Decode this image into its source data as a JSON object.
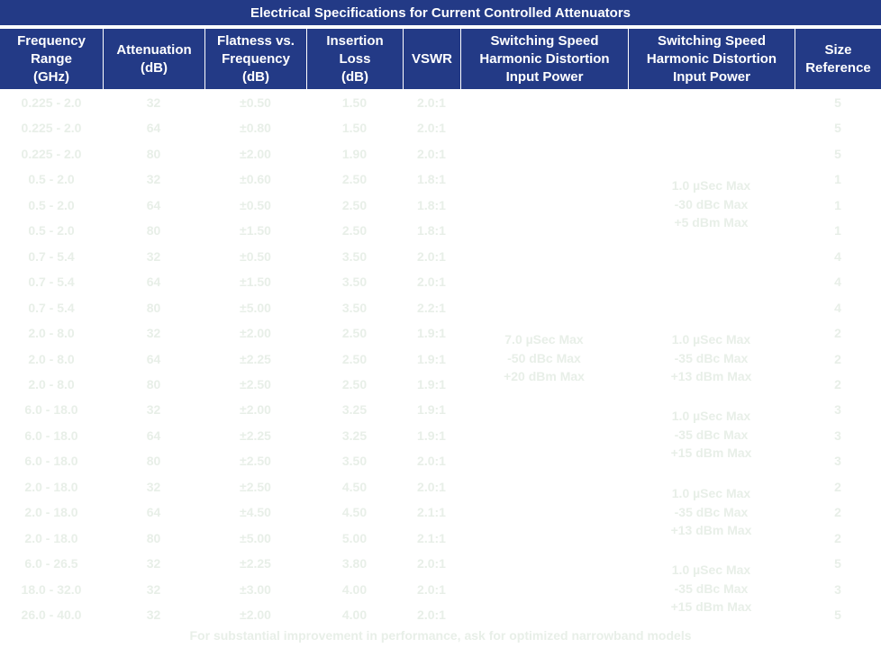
{
  "title": "Electrical Specifications for Current Controlled Attenuators",
  "headers": [
    [
      "Frequency",
      "Range",
      "(GHz)"
    ],
    [
      "Attenuation",
      "(dB)"
    ],
    [
      "Flatness vs.",
      "Frequency",
      "(dB)"
    ],
    [
      "Insertion",
      "Loss",
      "(dB)"
    ],
    [
      "VSWR"
    ],
    [
      "Switching Speed",
      "Harmonic Distortion",
      "Input Power"
    ],
    [
      "Switching Speed",
      "Harmonic Distortion",
      "Input Power"
    ],
    [
      "Size",
      "Reference"
    ]
  ],
  "rows": [
    [
      "0.225 - 2.0",
      "32",
      "±0.50",
      "1.50",
      "2.0:1",
      "5"
    ],
    [
      "0.225 - 2.0",
      "64",
      "±0.80",
      "1.50",
      "2.0:1",
      "5"
    ],
    [
      "0.225 - 2.0",
      "80",
      "±2.00",
      "1.90",
      "2.0:1",
      "5"
    ],
    [
      "0.5 - 2.0",
      "32",
      "±0.60",
      "2.50",
      "1.8:1",
      "1"
    ],
    [
      "0.5 - 2.0",
      "64",
      "±0.50",
      "2.50",
      "1.8:1",
      "1"
    ],
    [
      "0.5 - 2.0",
      "80",
      "±1.50",
      "2.50",
      "1.8:1",
      "1"
    ],
    [
      "0.7 - 5.4",
      "32",
      "±0.50",
      "3.50",
      "2.0:1",
      "4"
    ],
    [
      "0.7 - 5.4",
      "64",
      "±1.50",
      "3.50",
      "2.0:1",
      "4"
    ],
    [
      "0.7 - 5.4",
      "80",
      "±5.00",
      "3.50",
      "2.2:1",
      "4"
    ],
    [
      "2.0 - 8.0",
      "32",
      "±2.00",
      "2.50",
      "1.9:1",
      "2"
    ],
    [
      "2.0 - 8.0",
      "64",
      "±2.25",
      "2.50",
      "1.9:1",
      "2"
    ],
    [
      "2.0 - 8.0",
      "80",
      "±2.50",
      "2.50",
      "1.9:1",
      "2"
    ],
    [
      "6.0 - 18.0",
      "32",
      "±2.00",
      "3.25",
      "1.9:1",
      "3"
    ],
    [
      "6.0 - 18.0",
      "64",
      "±2.25",
      "3.25",
      "1.9:1",
      "3"
    ],
    [
      "6.0 - 18.0",
      "80",
      "±2.50",
      "3.50",
      "2.0:1",
      "3"
    ],
    [
      "2.0 - 18.0",
      "32",
      "±2.50",
      "4.50",
      "2.0:1",
      "2"
    ],
    [
      "2.0 - 18.0",
      "64",
      "±4.50",
      "4.50",
      "2.1:1",
      "2"
    ],
    [
      "2.0 - 18.0",
      "80",
      "±5.00",
      "5.00",
      "2.1:1",
      "2"
    ],
    [
      "6.0 - 26.5",
      "32",
      "±2.25",
      "3.80",
      "2.0:1",
      "5"
    ],
    [
      "18.0 - 32.0",
      "32",
      "±3.00",
      "4.00",
      "2.0:1",
      "3"
    ],
    [
      "26.0 - 40.0",
      "32",
      "±2.00",
      "4.00",
      "2.0:1",
      "5"
    ]
  ],
  "switching_col1": [
    "7.0 µSec Max",
    "-50 dBc Max",
    "+20 dBm Max"
  ],
  "switching_col2_groups": [
    [
      "1.0 µSec Max",
      "-30 dBc Max",
      "+5 dBm Max"
    ],
    [
      "1.0 µSec Max",
      "-35 dBc Max",
      "+13 dBm Max"
    ],
    [
      "1.0 µSec Max",
      "-35 dBc Max",
      "+15 dBm Max"
    ],
    [
      "1.0 µSec Max",
      "-35 dBc Max",
      "+13 dBm Max"
    ],
    [
      "1.0 µSec Max",
      "-35 dBc Max",
      "+15 dBm Max"
    ]
  ],
  "footnote": "For substantial improvement in performance, ask for optimized narrowband models",
  "colors": {
    "header_bg": "#233a86",
    "header_text": "#ffffff",
    "body_text": "#e8efe8"
  }
}
